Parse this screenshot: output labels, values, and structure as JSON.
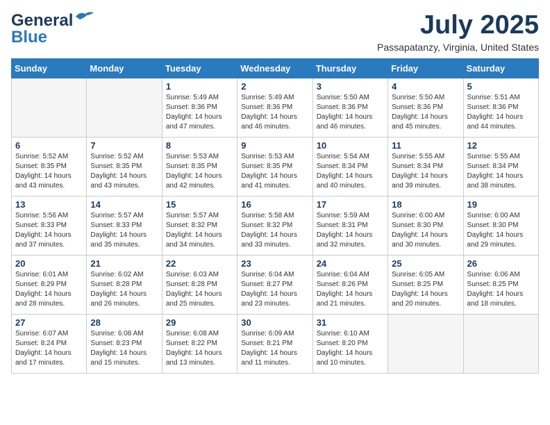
{
  "header": {
    "logo_general": "General",
    "logo_blue": "Blue",
    "month_title": "July 2025",
    "location": "Passapatanzy, Virginia, United States"
  },
  "weekdays": [
    "Sunday",
    "Monday",
    "Tuesday",
    "Wednesday",
    "Thursday",
    "Friday",
    "Saturday"
  ],
  "weeks": [
    [
      {
        "day": "",
        "sunrise": "",
        "sunset": "",
        "daylight": ""
      },
      {
        "day": "",
        "sunrise": "",
        "sunset": "",
        "daylight": ""
      },
      {
        "day": "1",
        "sunrise": "Sunrise: 5:49 AM",
        "sunset": "Sunset: 8:36 PM",
        "daylight": "Daylight: 14 hours and 47 minutes."
      },
      {
        "day": "2",
        "sunrise": "Sunrise: 5:49 AM",
        "sunset": "Sunset: 8:36 PM",
        "daylight": "Daylight: 14 hours and 46 minutes."
      },
      {
        "day": "3",
        "sunrise": "Sunrise: 5:50 AM",
        "sunset": "Sunset: 8:36 PM",
        "daylight": "Daylight: 14 hours and 46 minutes."
      },
      {
        "day": "4",
        "sunrise": "Sunrise: 5:50 AM",
        "sunset": "Sunset: 8:36 PM",
        "daylight": "Daylight: 14 hours and 45 minutes."
      },
      {
        "day": "5",
        "sunrise": "Sunrise: 5:51 AM",
        "sunset": "Sunset: 8:36 PM",
        "daylight": "Daylight: 14 hours and 44 minutes."
      }
    ],
    [
      {
        "day": "6",
        "sunrise": "Sunrise: 5:52 AM",
        "sunset": "Sunset: 8:35 PM",
        "daylight": "Daylight: 14 hours and 43 minutes."
      },
      {
        "day": "7",
        "sunrise": "Sunrise: 5:52 AM",
        "sunset": "Sunset: 8:35 PM",
        "daylight": "Daylight: 14 hours and 43 minutes."
      },
      {
        "day": "8",
        "sunrise": "Sunrise: 5:53 AM",
        "sunset": "Sunset: 8:35 PM",
        "daylight": "Daylight: 14 hours and 42 minutes."
      },
      {
        "day": "9",
        "sunrise": "Sunrise: 5:53 AM",
        "sunset": "Sunset: 8:35 PM",
        "daylight": "Daylight: 14 hours and 41 minutes."
      },
      {
        "day": "10",
        "sunrise": "Sunrise: 5:54 AM",
        "sunset": "Sunset: 8:34 PM",
        "daylight": "Daylight: 14 hours and 40 minutes."
      },
      {
        "day": "11",
        "sunrise": "Sunrise: 5:55 AM",
        "sunset": "Sunset: 8:34 PM",
        "daylight": "Daylight: 14 hours and 39 minutes."
      },
      {
        "day": "12",
        "sunrise": "Sunrise: 5:55 AM",
        "sunset": "Sunset: 8:34 PM",
        "daylight": "Daylight: 14 hours and 38 minutes."
      }
    ],
    [
      {
        "day": "13",
        "sunrise": "Sunrise: 5:56 AM",
        "sunset": "Sunset: 8:33 PM",
        "daylight": "Daylight: 14 hours and 37 minutes."
      },
      {
        "day": "14",
        "sunrise": "Sunrise: 5:57 AM",
        "sunset": "Sunset: 8:33 PM",
        "daylight": "Daylight: 14 hours and 35 minutes."
      },
      {
        "day": "15",
        "sunrise": "Sunrise: 5:57 AM",
        "sunset": "Sunset: 8:32 PM",
        "daylight": "Daylight: 14 hours and 34 minutes."
      },
      {
        "day": "16",
        "sunrise": "Sunrise: 5:58 AM",
        "sunset": "Sunset: 8:32 PM",
        "daylight": "Daylight: 14 hours and 33 minutes."
      },
      {
        "day": "17",
        "sunrise": "Sunrise: 5:59 AM",
        "sunset": "Sunset: 8:31 PM",
        "daylight": "Daylight: 14 hours and 32 minutes."
      },
      {
        "day": "18",
        "sunrise": "Sunrise: 6:00 AM",
        "sunset": "Sunset: 8:30 PM",
        "daylight": "Daylight: 14 hours and 30 minutes."
      },
      {
        "day": "19",
        "sunrise": "Sunrise: 6:00 AM",
        "sunset": "Sunset: 8:30 PM",
        "daylight": "Daylight: 14 hours and 29 minutes."
      }
    ],
    [
      {
        "day": "20",
        "sunrise": "Sunrise: 6:01 AM",
        "sunset": "Sunset: 8:29 PM",
        "daylight": "Daylight: 14 hours and 28 minutes."
      },
      {
        "day": "21",
        "sunrise": "Sunrise: 6:02 AM",
        "sunset": "Sunset: 8:28 PM",
        "daylight": "Daylight: 14 hours and 26 minutes."
      },
      {
        "day": "22",
        "sunrise": "Sunrise: 6:03 AM",
        "sunset": "Sunset: 8:28 PM",
        "daylight": "Daylight: 14 hours and 25 minutes."
      },
      {
        "day": "23",
        "sunrise": "Sunrise: 6:04 AM",
        "sunset": "Sunset: 8:27 PM",
        "daylight": "Daylight: 14 hours and 23 minutes."
      },
      {
        "day": "24",
        "sunrise": "Sunrise: 6:04 AM",
        "sunset": "Sunset: 8:26 PM",
        "daylight": "Daylight: 14 hours and 21 minutes."
      },
      {
        "day": "25",
        "sunrise": "Sunrise: 6:05 AM",
        "sunset": "Sunset: 8:25 PM",
        "daylight": "Daylight: 14 hours and 20 minutes."
      },
      {
        "day": "26",
        "sunrise": "Sunrise: 6:06 AM",
        "sunset": "Sunset: 8:25 PM",
        "daylight": "Daylight: 14 hours and 18 minutes."
      }
    ],
    [
      {
        "day": "27",
        "sunrise": "Sunrise: 6:07 AM",
        "sunset": "Sunset: 8:24 PM",
        "daylight": "Daylight: 14 hours and 17 minutes."
      },
      {
        "day": "28",
        "sunrise": "Sunrise: 6:08 AM",
        "sunset": "Sunset: 8:23 PM",
        "daylight": "Daylight: 14 hours and 15 minutes."
      },
      {
        "day": "29",
        "sunrise": "Sunrise: 6:08 AM",
        "sunset": "Sunset: 8:22 PM",
        "daylight": "Daylight: 14 hours and 13 minutes."
      },
      {
        "day": "30",
        "sunrise": "Sunrise: 6:09 AM",
        "sunset": "Sunset: 8:21 PM",
        "daylight": "Daylight: 14 hours and 11 minutes."
      },
      {
        "day": "31",
        "sunrise": "Sunrise: 6:10 AM",
        "sunset": "Sunset: 8:20 PM",
        "daylight": "Daylight: 14 hours and 10 minutes."
      },
      {
        "day": "",
        "sunrise": "",
        "sunset": "",
        "daylight": ""
      },
      {
        "day": "",
        "sunrise": "",
        "sunset": "",
        "daylight": ""
      }
    ]
  ]
}
